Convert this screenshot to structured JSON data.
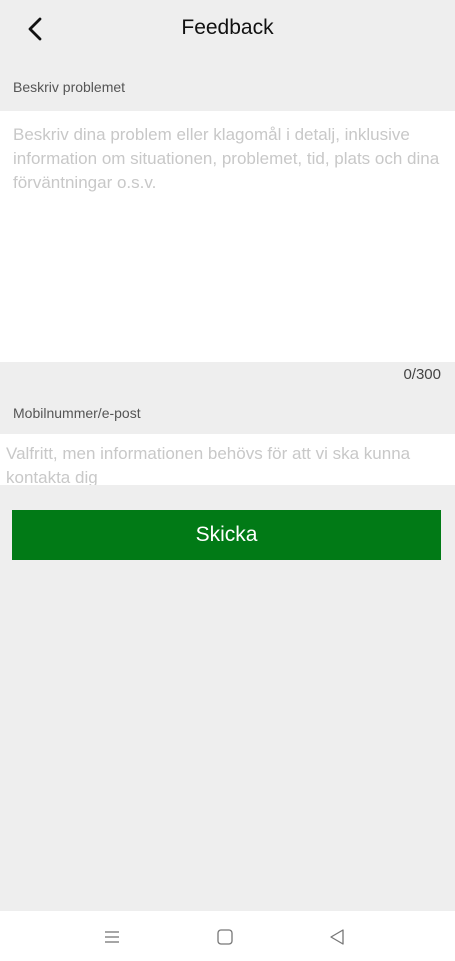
{
  "header": {
    "title": "Feedback",
    "back_icon": "chevron-left-icon"
  },
  "description": {
    "label": "Beskriv problemet",
    "value": "",
    "placeholder": "Beskriv dina problem eller klagomål i detalj, inklusive information om situationen, problemet, tid, plats och dina förväntningar o.s.v.",
    "counter": "0/300"
  },
  "contact": {
    "label": "Mobilnummer/e-post",
    "value": "",
    "placeholder": "Valfritt, men informationen behövs för att vi ska kunna kontakta dig"
  },
  "submit": {
    "label": "Skicka",
    "color": "#017a16"
  },
  "navbar": {
    "icons": [
      "menu-icon",
      "home-square-icon",
      "back-triangle-icon"
    ]
  }
}
